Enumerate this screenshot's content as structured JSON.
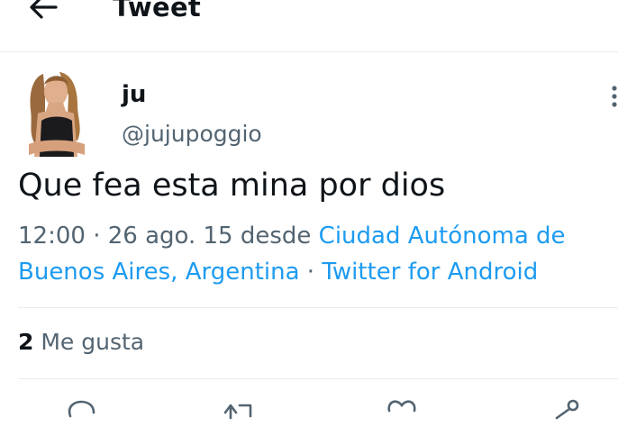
{
  "header": {
    "title": "Tweet",
    "back_icon": "arrow-left-icon"
  },
  "tweet": {
    "display_name": "ju",
    "handle": "@jujupoggio",
    "text": "Que fea esta mina por dios",
    "time": "12:00",
    "sep1": " · ",
    "date": "26 ago. 15",
    "desde": " desde ",
    "location": "Ciudad Autónoma de Buenos Aires, Argentina",
    "sep2": " · ",
    "source": "Twitter for Android"
  },
  "stats": {
    "likes_count": "2",
    "likes_label": " Me gusta"
  },
  "actions": {
    "reply_icon": "reply-icon",
    "retweet_icon": "retweet-icon",
    "like_icon": "heart-icon",
    "share_icon": "share-icon"
  },
  "colors": {
    "link": "#1d9bf0",
    "secondary_text": "#536471",
    "divider": "#e6ecf0"
  }
}
